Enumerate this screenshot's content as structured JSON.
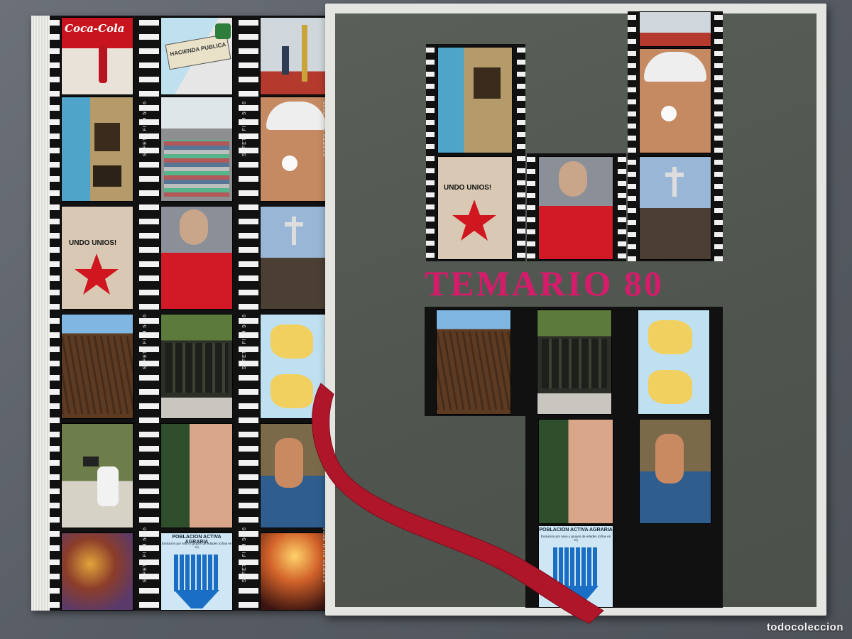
{
  "cover": {
    "title": "TEMARIO 80",
    "title_color": "#d41c6a",
    "case_color": "#52574f"
  },
  "film": {
    "edge_text": "SAFETY FILM 5036",
    "edge_text_short": "SAFE",
    "sign_text": "UNDO UNIOS!",
    "brand_sign": "Coca-Cola",
    "bottle_label": "HACIENDA PUBLICA"
  },
  "chart_frame": {
    "title": "POBLACION ACTIVA AGRARIA",
    "subtitle": "Evolución por sexo y grupos de edades (cifras en %)"
  },
  "ribbon": {
    "color": "#b0162a"
  },
  "watermark": "todocoleccion"
}
